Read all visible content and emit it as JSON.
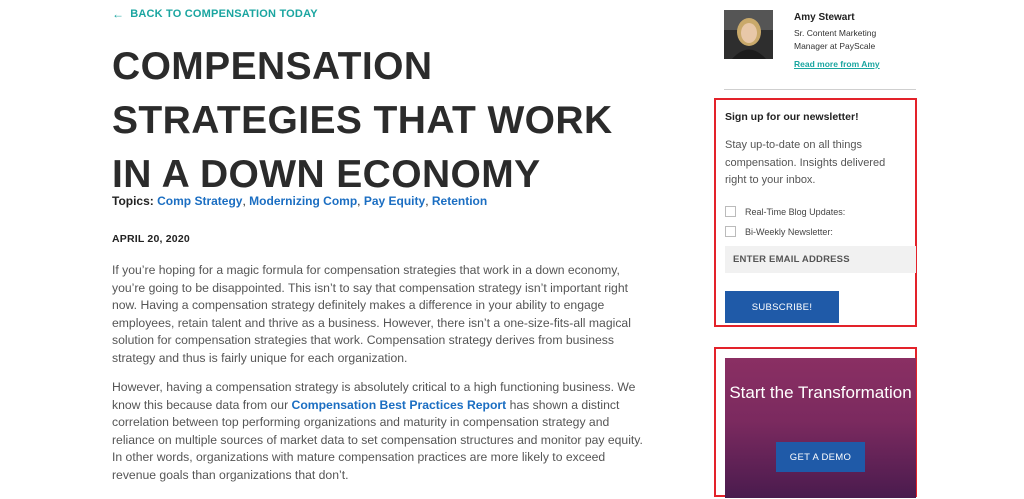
{
  "back_link": {
    "label": "BACK TO COMPENSATION TODAY",
    "icon": "arrow-left-icon"
  },
  "article": {
    "title": "COMPENSATION STRATEGIES THAT WORK IN A DOWN ECONOMY",
    "topics_label": "Topics:",
    "topics": [
      "Comp Strategy",
      "Modernizing Comp",
      "Pay Equity",
      "Retention"
    ],
    "date": "APRIL 20, 2020",
    "para1": "If you’re hoping for a magic formula for compensation strategies that work in a down economy, you’re going to be disappointed. This isn’t to say that compensation strategy isn’t important right now. Having a compensation strategy definitely makes a difference in your ability to engage employees, retain talent and thrive as a business. However, there isn’t a one-size-fits-all magical solution for compensation strategies that work. Compensation strategy derives from business strategy and thus is fairly unique for each organization.",
    "para2_before": "However, having a compensation strategy is absolutely critical to a high functioning business. We know this because data from our ",
    "para2_link": "Compensation Best Practices Report",
    "para2_after": " has shown a distinct correlation between top performing organizations and maturity in compensation strategy and reliance on multiple sources of market data to set compensation structures and monitor pay equity. In other words, organizations with mature compensation practices are more likely to exceed revenue goals than organizations that don’t."
  },
  "author": {
    "name": "Amy Stewart",
    "role": "Sr. Content Marketing Manager at PayScale",
    "link": "Read more from Amy"
  },
  "newsletter": {
    "title": "Sign up for our newsletter!",
    "description": "Stay up-to-date on all things compensation. Insights delivered right to your inbox.",
    "option1": "Real-Time Blog Updates:",
    "option2": "Bi-Weekly Newsletter:",
    "email_placeholder": "ENTER EMAIL ADDRESS",
    "submit": "SUBSCRIBE!"
  },
  "cta": {
    "title": "Start the Transformation",
    "button": "GET A DEMO"
  },
  "colors": {
    "accent_teal": "#1aa5a0",
    "link_blue": "#1b6ec2",
    "button_blue": "#1f5aa8",
    "highlight_red": "#e3222a"
  }
}
